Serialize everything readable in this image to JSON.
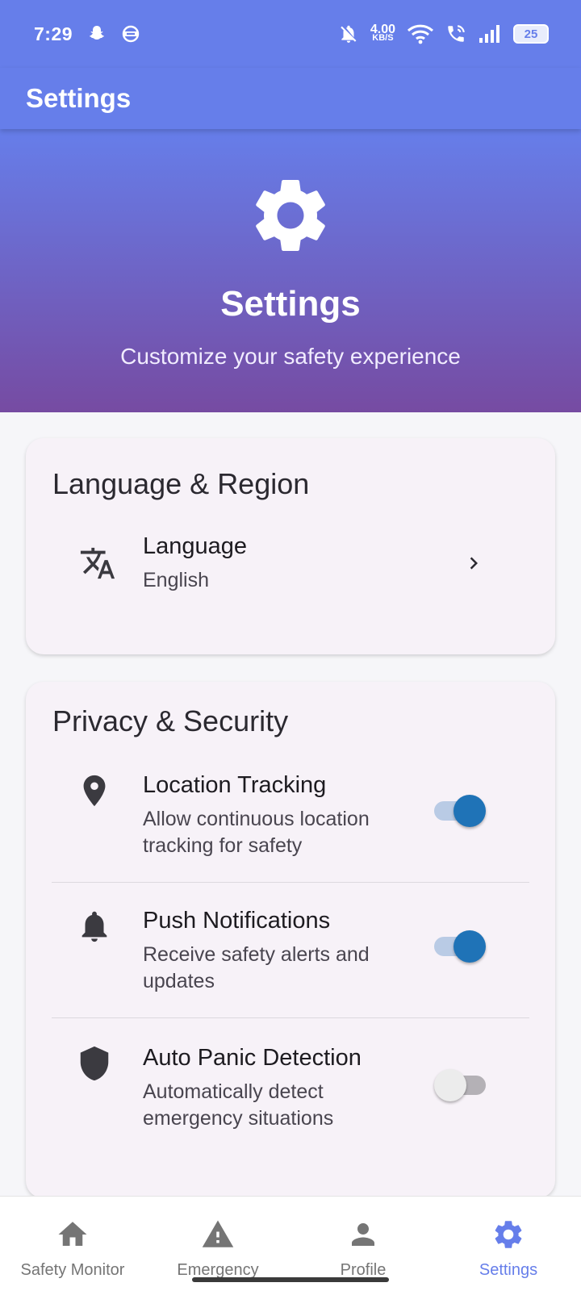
{
  "status_bar": {
    "time": "7:29",
    "net_speed_value": "4.00",
    "net_speed_unit": "KB/S",
    "battery": "25"
  },
  "app_bar": {
    "title": "Settings"
  },
  "hero": {
    "icon": "gear-icon",
    "title": "Settings",
    "subtitle": "Customize your safety experience"
  },
  "language_region": {
    "title": "Language & Region",
    "language": {
      "icon": "translate-icon",
      "title": "Language",
      "value": "English"
    }
  },
  "privacy_security": {
    "title": "Privacy & Security",
    "items": [
      {
        "icon": "location-pin-icon",
        "title": "Location Tracking",
        "subtitle": "Allow continuous location tracking for safety",
        "enabled": true
      },
      {
        "icon": "bell-icon",
        "title": "Push Notifications",
        "subtitle": "Receive safety alerts and updates",
        "enabled": true
      },
      {
        "icon": "shield-icon",
        "title": "Auto Panic Detection",
        "subtitle": "Automatically detect emergency situations",
        "enabled": false
      }
    ]
  },
  "bottom_nav": {
    "items": [
      {
        "icon": "home-icon",
        "label": "Safety Monitor",
        "active": false
      },
      {
        "icon": "warning-icon",
        "label": "Emergency",
        "active": false
      },
      {
        "icon": "person-icon",
        "label": "Profile",
        "active": false
      },
      {
        "icon": "gear-icon",
        "label": "Settings",
        "active": true
      }
    ]
  },
  "colors": {
    "primary": "#667eea",
    "gradient_end": "#764ba2",
    "switch_on": "#1f73b7"
  }
}
